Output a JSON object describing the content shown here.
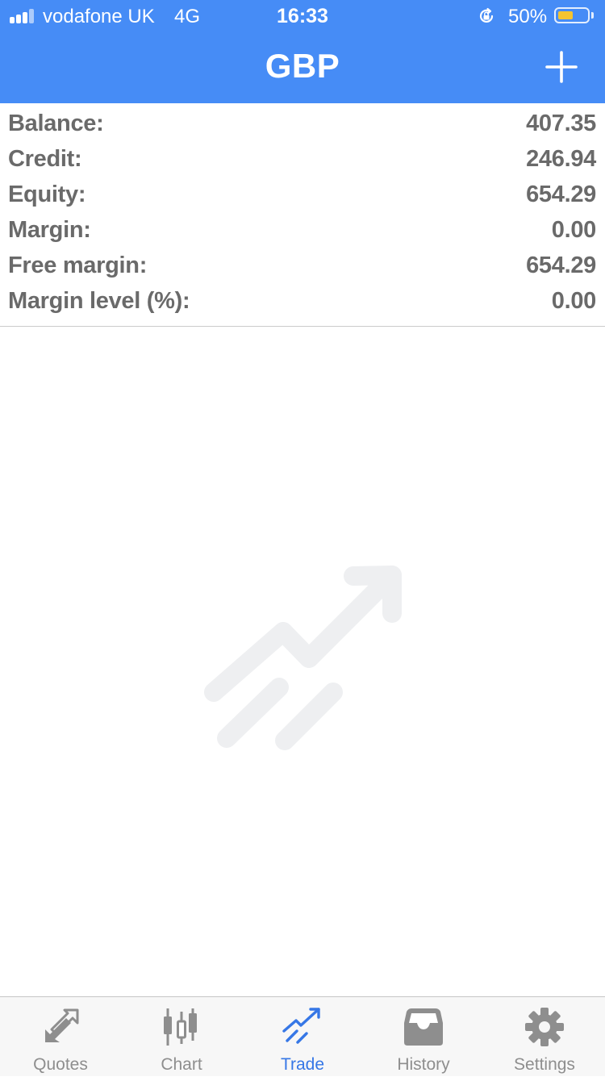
{
  "status_bar": {
    "carrier": "vodafone UK",
    "network": "4G",
    "time": "16:33",
    "battery_percent": "50%",
    "battery_level": 0.5
  },
  "header": {
    "title": "GBP",
    "add_icon": "plus-icon"
  },
  "summary": [
    {
      "label": "Balance:",
      "value": "407.35"
    },
    {
      "label": "Credit:",
      "value": "246.94"
    },
    {
      "label": "Equity:",
      "value": "654.29"
    },
    {
      "label": "Margin:",
      "value": "0.00"
    },
    {
      "label": "Free margin:",
      "value": "654.29"
    },
    {
      "label": "Margin level (%):",
      "value": "0.00"
    }
  ],
  "empty_state": {
    "icon": "trade-trend-icon"
  },
  "tabbar": {
    "items": [
      {
        "label": "Quotes",
        "icon": "quotes-arrows-icon",
        "active": false
      },
      {
        "label": "Chart",
        "icon": "candlestick-icon",
        "active": false
      },
      {
        "label": "Trade",
        "icon": "trade-trend-icon",
        "active": true
      },
      {
        "label": "History",
        "icon": "inbox-tray-icon",
        "active": false
      },
      {
        "label": "Settings",
        "icon": "gear-icon",
        "active": false
      }
    ]
  },
  "colors": {
    "header_bg": "#468cf6",
    "active_tab": "#3677e6",
    "inactive_tab": "#8e8e8e",
    "summary_text": "#6a6a6a",
    "battery_fill": "#f4c430"
  }
}
